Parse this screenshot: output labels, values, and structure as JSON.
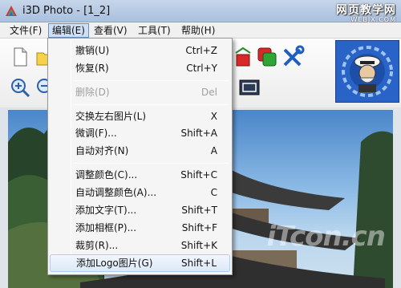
{
  "window": {
    "title": "i3D Photo - [1_2]",
    "watermark_main": "网页教学网",
    "watermark_sub": "WEBJX.COM"
  },
  "menubar": {
    "items": [
      {
        "label": "文件(F)"
      },
      {
        "label": "编辑(E)"
      },
      {
        "label": "查看(V)"
      },
      {
        "label": "工具(T)"
      },
      {
        "label": "帮助(H)"
      }
    ]
  },
  "edit_menu": {
    "items": [
      {
        "label": "撤销(U)",
        "shortcut": "Ctrl+Z"
      },
      {
        "label": "恢复(R)",
        "shortcut": "Ctrl+Y"
      },
      {
        "label": "删除(D)",
        "shortcut": "Del"
      },
      {
        "label": "交换左右图片(L)",
        "shortcut": "X"
      },
      {
        "label": "微调(F)...",
        "shortcut": "Shift+A"
      },
      {
        "label": "自动对齐(N)",
        "shortcut": "A"
      },
      {
        "label": "调整颜色(C)...",
        "shortcut": "Shift+C"
      },
      {
        "label": "自动调整颜色(A)...",
        "shortcut": "C"
      },
      {
        "label": "添加文字(T)...",
        "shortcut": "Shift+T"
      },
      {
        "label": "添加相框(P)...",
        "shortcut": "Shift+F"
      },
      {
        "label": "裁剪(R)...",
        "shortcut": "Shift+K"
      },
      {
        "label": "添加Logo图片(G)",
        "shortcut": "Shift+L"
      }
    ]
  },
  "photo": {
    "watermark": "iTcon.cn"
  },
  "colors": {
    "accent": "#6e8fbf",
    "logo_bg": "#2a63c7"
  },
  "icons": [
    "app-icon",
    "new-file-icon",
    "open-folder-icon",
    "zoom-in-icon",
    "zoom-out-icon",
    "red-square-icon",
    "green-square-icon",
    "tools-icon",
    "fit-screen-icon",
    "captain-logo-icon"
  ]
}
